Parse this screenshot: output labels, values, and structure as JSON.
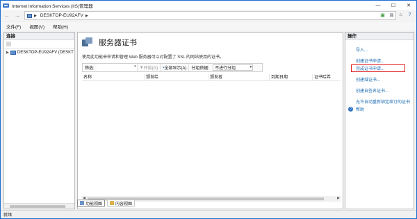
{
  "window": {
    "title": "Internet Information Services (IIS)管理器",
    "controls": [
      "—",
      "☐",
      "✕"
    ]
  },
  "address": {
    "back_icon": "back-arrow-icon",
    "forward_icon": "forward-arrow-icon",
    "path": "DESKTOP-EU92AFV",
    "right_icons": [
      "network-icon",
      "stop-icon",
      "home-icon",
      "help-icon"
    ]
  },
  "menu": [
    "文件(F)",
    "视图(V)",
    "帮助(H)"
  ],
  "connections": {
    "header": "连接",
    "tree": [
      {
        "label": "DESKTOP-EU92AFV (DESKT"
      }
    ]
  },
  "main": {
    "title": "服务器证书",
    "description": "使用此功能来申请和管理 Web 服务器可以对配置了 SSL 的网站使用的证书。",
    "filter": {
      "label": "筛选:",
      "start": "开始(G)",
      "show_all": "全部显示(A)",
      "group_by_label": "分组依据:",
      "group_by_value": "不进行分组"
    },
    "columns": [
      "名称",
      "颁发给",
      "颁发者",
      "到期日期",
      "证书哈希"
    ],
    "view_tabs": [
      "功能视图",
      "内容视图"
    ]
  },
  "actions": {
    "header": "操作",
    "items": [
      "导入...",
      "创建证书申请...",
      "完成证书申请...",
      "创建域证书...",
      "创建自签名证书...",
      "允许自动重新绑定续订的证书"
    ],
    "help": "帮助"
  },
  "status": {
    "text": "就绪"
  }
}
